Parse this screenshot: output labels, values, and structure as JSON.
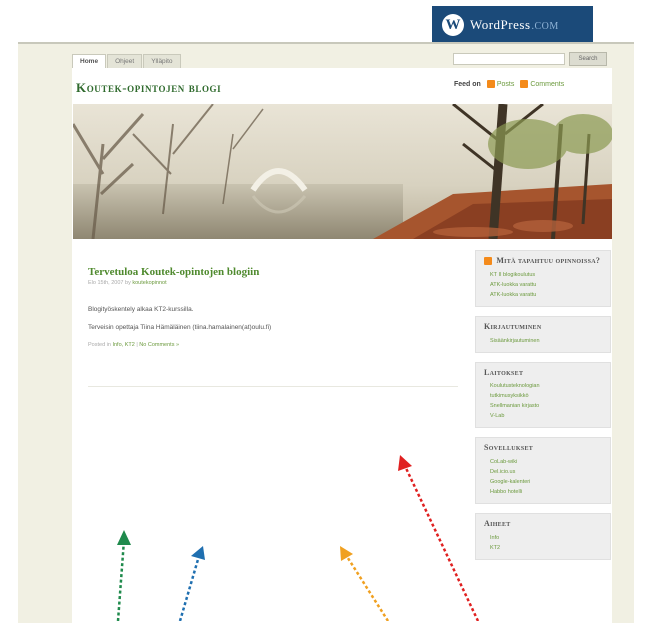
{
  "wordpress_banner": {
    "mark": "W",
    "brand": "WordPress",
    "domain_suffix": ".COM"
  },
  "top_nav": {
    "tabs": [
      "Home",
      "Ohjeet",
      "Ylläpito"
    ],
    "active": 0
  },
  "search": {
    "placeholder": "",
    "button_label": "Search"
  },
  "blog": {
    "title": "Koutek-opintojen blogi"
  },
  "feed": {
    "label": "Feed on",
    "posts": "Posts",
    "comments": "Comments"
  },
  "post": {
    "title": "Tervetuloa Koutek-opintojen blogiin",
    "date": "Elo 15th, 2007",
    "author_prefix": "by",
    "author": "koutekopinnot",
    "paragraphs": [
      "Blogityöskentely alkaa KT2-kurssilla.",
      "Terveisin opettaja Tiina Hämäläinen (tiina.hamalainen(at)oulu.fi)"
    ],
    "posted_in_label": "Posted in",
    "categories": "Info, KT2",
    "comments_link": "No Comments »"
  },
  "sidebar": {
    "widgets": [
      {
        "title": "Mitä tapahtuu opinnoissa?",
        "has_rss": true,
        "items": [
          "KT II blogikoulutus",
          "ATK-luokka varattu",
          "ATK-luokka varattu"
        ]
      },
      {
        "title": "Kirjautuminen",
        "has_rss": false,
        "items": [
          "Sisäänkirjautuminen"
        ]
      },
      {
        "title": "Laitokset",
        "has_rss": false,
        "items": [
          "Koulutusteknologian",
          "tutkimusyksikkö",
          "Snellmanian kirjasto",
          "V-Lab"
        ]
      },
      {
        "title": "Sovellukset",
        "has_rss": false,
        "items": [
          "CoLab-wiki",
          "Del.icio.us",
          "Google-kalenteri",
          "Habbo hotelli"
        ]
      },
      {
        "title": "Aiheet",
        "has_rss": false,
        "items": [
          "Info",
          "KT2"
        ]
      }
    ]
  },
  "annotation_arrows": {
    "colors": [
      "#1f8a4c",
      "#1f6fb0",
      "#f0a020",
      "#e02020"
    ]
  }
}
